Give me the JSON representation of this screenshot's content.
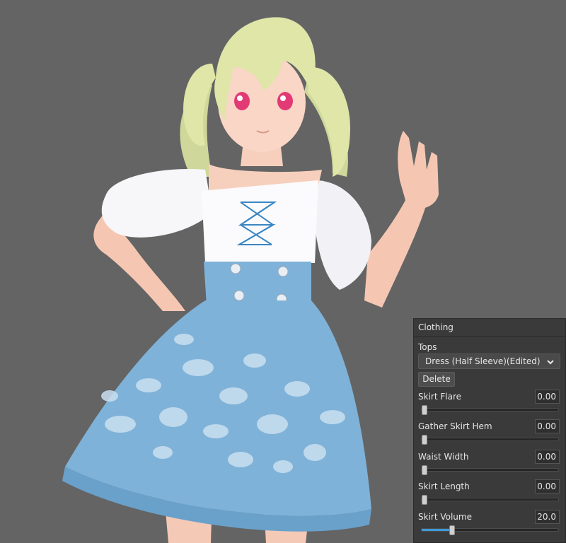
{
  "panel": {
    "title": "Clothing",
    "section_label": "Tops",
    "dropdown_value": "Dress (Half Sleeve)(Edited)",
    "delete_label": "Delete",
    "sliders": [
      {
        "label": "Skirt Flare",
        "value": "0.00",
        "level": 0
      },
      {
        "label": "Gather Skirt Hem",
        "value": "0.00",
        "level": 0
      },
      {
        "label": "Waist Width",
        "value": "0.00",
        "level": 0
      },
      {
        "label": "Skirt Length",
        "value": "0.00",
        "level": 0
      },
      {
        "label": "Skirt Volume",
        "value": "20.0",
        "level": 0.2
      }
    ]
  },
  "colors": {
    "viewport_bg": "#646464",
    "panel_bg": "#3a3a3a",
    "slider_fill": "#3d9ad6",
    "dress_blue": "#7fb2d8",
    "hair": "#dfe6a8"
  }
}
